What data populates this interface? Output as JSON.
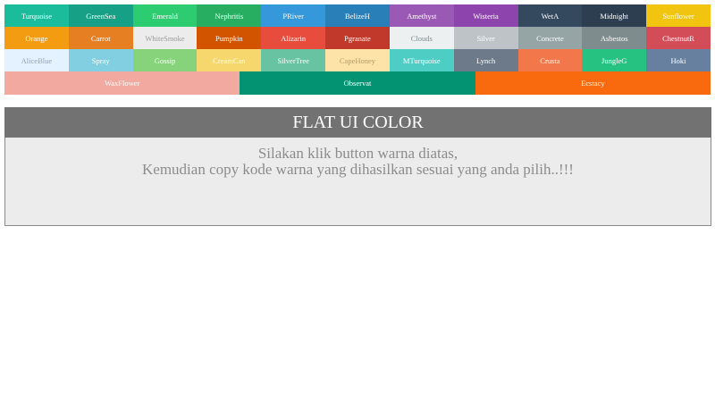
{
  "rows": [
    [
      {
        "label": "Turquoise",
        "bg": "#1abc9c",
        "fg": "#ffffff"
      },
      {
        "label": "GreenSea",
        "bg": "#16a085",
        "fg": "#ffffff"
      },
      {
        "label": "Emerald",
        "bg": "#2ecc71",
        "fg": "#ffffff"
      },
      {
        "label": "Nephritis",
        "bg": "#27ae60",
        "fg": "#ffffff"
      },
      {
        "label": "PRiver",
        "bg": "#3498db",
        "fg": "#ffffff"
      },
      {
        "label": "BelizeH",
        "bg": "#2980b9",
        "fg": "#ffffff"
      },
      {
        "label": "Amethyst",
        "bg": "#9b59b6",
        "fg": "#ffffff"
      },
      {
        "label": "Wisteria",
        "bg": "#8e44ad",
        "fg": "#ffffff"
      },
      {
        "label": "WetA",
        "bg": "#34495e",
        "fg": "#ffffff"
      },
      {
        "label": "Midnight",
        "bg": "#2c3e50",
        "fg": "#ffffff"
      },
      {
        "label": "Sunflower",
        "bg": "#f1c40f",
        "fg": "#ffffff"
      }
    ],
    [
      {
        "label": "Orange",
        "bg": "#f39c12",
        "fg": "#ffffff"
      },
      {
        "label": "Carrot",
        "bg": "#e67e22",
        "fg": "#ffffff"
      },
      {
        "label": "WhiteSmoke",
        "bg": "#ececec",
        "fg": "#9a9a9a"
      },
      {
        "label": "Pumpkin",
        "bg": "#d35400",
        "fg": "#ffffff"
      },
      {
        "label": "Alizarin",
        "bg": "#e74c3c",
        "fg": "#ffffff"
      },
      {
        "label": "Pgranate",
        "bg": "#c0392b",
        "fg": "#ffffff"
      },
      {
        "label": "Clouds",
        "bg": "#ecf0f1",
        "fg": "#7f8c8d"
      },
      {
        "label": "Silver",
        "bg": "#bdc3c7",
        "fg": "#ffffff"
      },
      {
        "label": "Concrete",
        "bg": "#95a5a6",
        "fg": "#ffffff"
      },
      {
        "label": "Asbestos",
        "bg": "#7f8c8d",
        "fg": "#ffffff"
      },
      {
        "label": "ChestnutR",
        "bg": "#d24d57",
        "fg": "#ffffff"
      }
    ],
    [
      {
        "label": "AliceBlue",
        "bg": "#e4f1fe",
        "fg": "#8fa3b8"
      },
      {
        "label": "Spray",
        "bg": "#81cfe0",
        "fg": "#ffffff"
      },
      {
        "label": "Gossip",
        "bg": "#87d37c",
        "fg": "#ffffff"
      },
      {
        "label": "CreamCan",
        "bg": "#f5d76e",
        "fg": "#ffffff"
      },
      {
        "label": "SilverTree",
        "bg": "#68c3a3",
        "fg": "#ffffff"
      },
      {
        "label": "CapeHoney",
        "bg": "#fde3a7",
        "fg": "#b59a66"
      },
      {
        "label": "MTurquoise",
        "bg": "#4ecdc4",
        "fg": "#ffffff"
      },
      {
        "label": "Lynch",
        "bg": "#6c7a89",
        "fg": "#ffffff"
      },
      {
        "label": "Crusta",
        "bg": "#f2784b",
        "fg": "#ffffff"
      },
      {
        "label": "JungleG",
        "bg": "#26c281",
        "fg": "#ffffff"
      },
      {
        "label": "Hoki",
        "bg": "#67809f",
        "fg": "#ffffff"
      }
    ],
    [
      {
        "label": "WaxFlower",
        "bg": "#f1a9a0",
        "fg": "#ffffff"
      },
      {
        "label": "Observat",
        "bg": "#049372",
        "fg": "#ffffff"
      },
      {
        "label": "Ecstacy",
        "bg": "#f9690e",
        "fg": "#ffffff"
      }
    ]
  ],
  "panel": {
    "title": "FLAT UI COLOR",
    "line1": "Silakan klik button warna diatas,",
    "line2": "Kemudian copy kode warna yang dihasilkan sesuai yang anda pilih..!!!"
  }
}
